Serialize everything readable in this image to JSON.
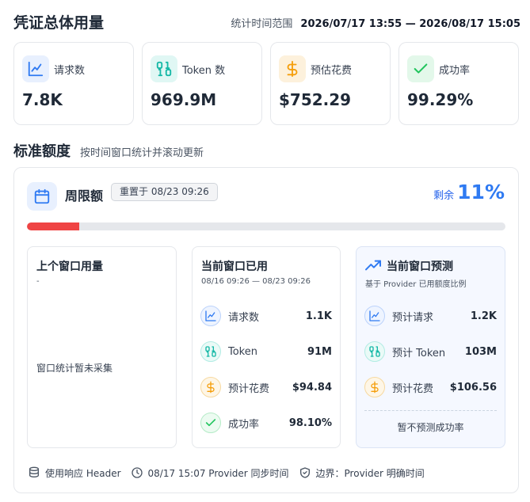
{
  "header": {
    "title": "凭证总体用量",
    "time_label": "统计时间范围",
    "time_range": "2026/07/17 13:55 — 2026/08/17 15:05"
  },
  "summary_cards": [
    {
      "label": "请求数",
      "value": "7.8K",
      "icon": "line-chart-icon"
    },
    {
      "label": "Token 数",
      "value": "969.9M",
      "icon": "binary-icon"
    },
    {
      "label": "预估花费",
      "value": "$752.29",
      "icon": "dollar-icon"
    },
    {
      "label": "成功率",
      "value": "99.29%",
      "icon": "check-icon"
    }
  ],
  "quota_section": {
    "title": "标准额度",
    "subtitle": "按时间窗口统计并滚动更新"
  },
  "weekly_limit": {
    "title": "周限额",
    "reset_badge": "重置于 08/23 09:26",
    "remaining_label": "剩余",
    "remaining_value": "11%",
    "used_fraction": 0.11
  },
  "previous_window": {
    "title": "上个窗口用量",
    "subtitle": "-",
    "no_data": "窗口统计暂未采集"
  },
  "current_window": {
    "title": "当前窗口已用",
    "range": "08/16 09:26 — 08/23 09:26",
    "rows": [
      {
        "label": "请求数",
        "value": "1.1K"
      },
      {
        "label": "Token",
        "value": "91M"
      },
      {
        "label": "预计花费",
        "value": "$94.84"
      },
      {
        "label": "成功率",
        "value": "98.10%"
      }
    ]
  },
  "prediction_window": {
    "title": "当前窗口预测",
    "subtitle": "基于 Provider 已用额度比例",
    "rows": [
      {
        "label": "预计请求",
        "value": "1.2K"
      },
      {
        "label": "预计 Token",
        "value": "103M"
      },
      {
        "label": "预计花费",
        "value": "$106.56"
      }
    ],
    "no_prediction": "暂不预测成功率"
  },
  "footer": {
    "header_text": "使用响应 Header",
    "sync_text": "08/17 15:07 Provider 同步时间",
    "boundary_text": "边界：Provider 明确时间"
  },
  "colors": {
    "blue": "#2f7af2",
    "teal": "#14b8a6",
    "amber": "#f59e0b",
    "green": "#22c55e",
    "red": "#ef4444"
  }
}
